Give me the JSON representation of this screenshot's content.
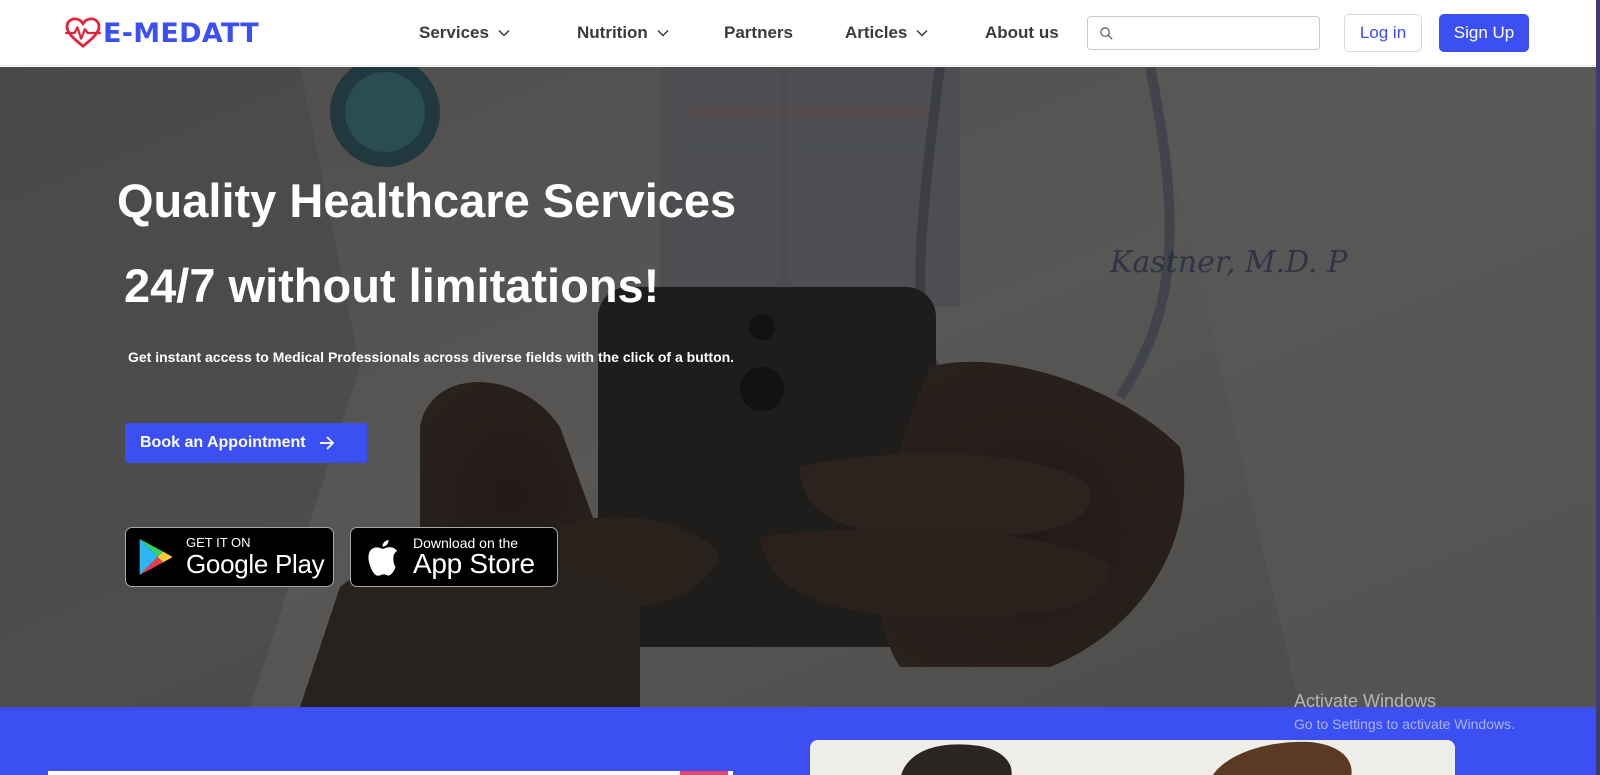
{
  "brand": {
    "name": "E-MEDATT",
    "accent": "#3b4ff3",
    "logo_icon": "heart-pulse-icon"
  },
  "nav": {
    "items": [
      {
        "label": "Services",
        "has_dropdown": true
      },
      {
        "label": "Nutrition",
        "has_dropdown": true
      },
      {
        "label": "Partners",
        "has_dropdown": false
      },
      {
        "label": "Articles",
        "has_dropdown": true
      },
      {
        "label": "About us",
        "has_dropdown": false
      }
    ],
    "search": {
      "placeholder": "",
      "value": "",
      "icon": "search-icon"
    },
    "login_label": "Log in",
    "signup_label": "Sign Up"
  },
  "hero": {
    "title": "Quality Healthcare Services",
    "subtitle": "24/7 without limitations!",
    "description": "Get instant access to Medical Professionals across diverse fields with the click of a button.",
    "cta_label": "Book an Appointment",
    "cta_icon": "arrow-right-icon",
    "google_play": {
      "small": "GET IT ON",
      "big": "Google Play"
    },
    "app_store": {
      "small": "Download on the",
      "big": "App Store"
    }
  },
  "os_watermark": {
    "title": "Activate Windows",
    "subtitle": "Go to Settings to activate Windows."
  }
}
